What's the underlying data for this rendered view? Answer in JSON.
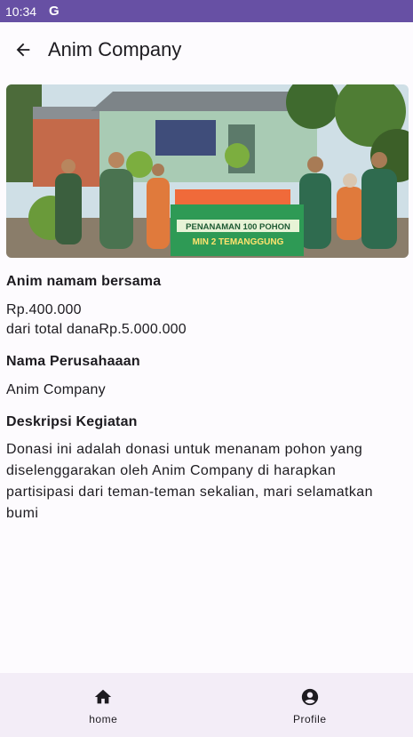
{
  "status_bar": {
    "time": "10:34",
    "app_indicator": "G"
  },
  "app_bar": {
    "title": "Anim Company",
    "back_icon": "arrow-back-icon"
  },
  "hero_image": {
    "description_icon": "photo-icon",
    "banner_line1": "PENANAMAN 100 POHON",
    "banner_line2": "MIN 2 TEMANGGUNG"
  },
  "donation": {
    "heading": "Anim namam bersama",
    "amount": "Rp.400.000",
    "total_text": "dari total danaRp.5.000.000"
  },
  "company": {
    "heading": "Nama Perusahaaan",
    "name": "Anim Company"
  },
  "description": {
    "heading": "Deskripsi Kegiatan",
    "text": "Donasi ini adalah donasi untuk menanam pohon yang diselenggarakan oleh Anim Company di harapkan partisipasi dari teman-teman sekalian, mari selamatkan bumi"
  },
  "bottom_nav": {
    "items": [
      {
        "label": "home",
        "icon": "home-icon"
      },
      {
        "label": "Profile",
        "icon": "account-circle-icon"
      }
    ]
  },
  "colors": {
    "primary": "#6750a4",
    "surface": "#fdfbfe",
    "nav_bg": "#f3edf7",
    "text": "#1d1b20"
  }
}
